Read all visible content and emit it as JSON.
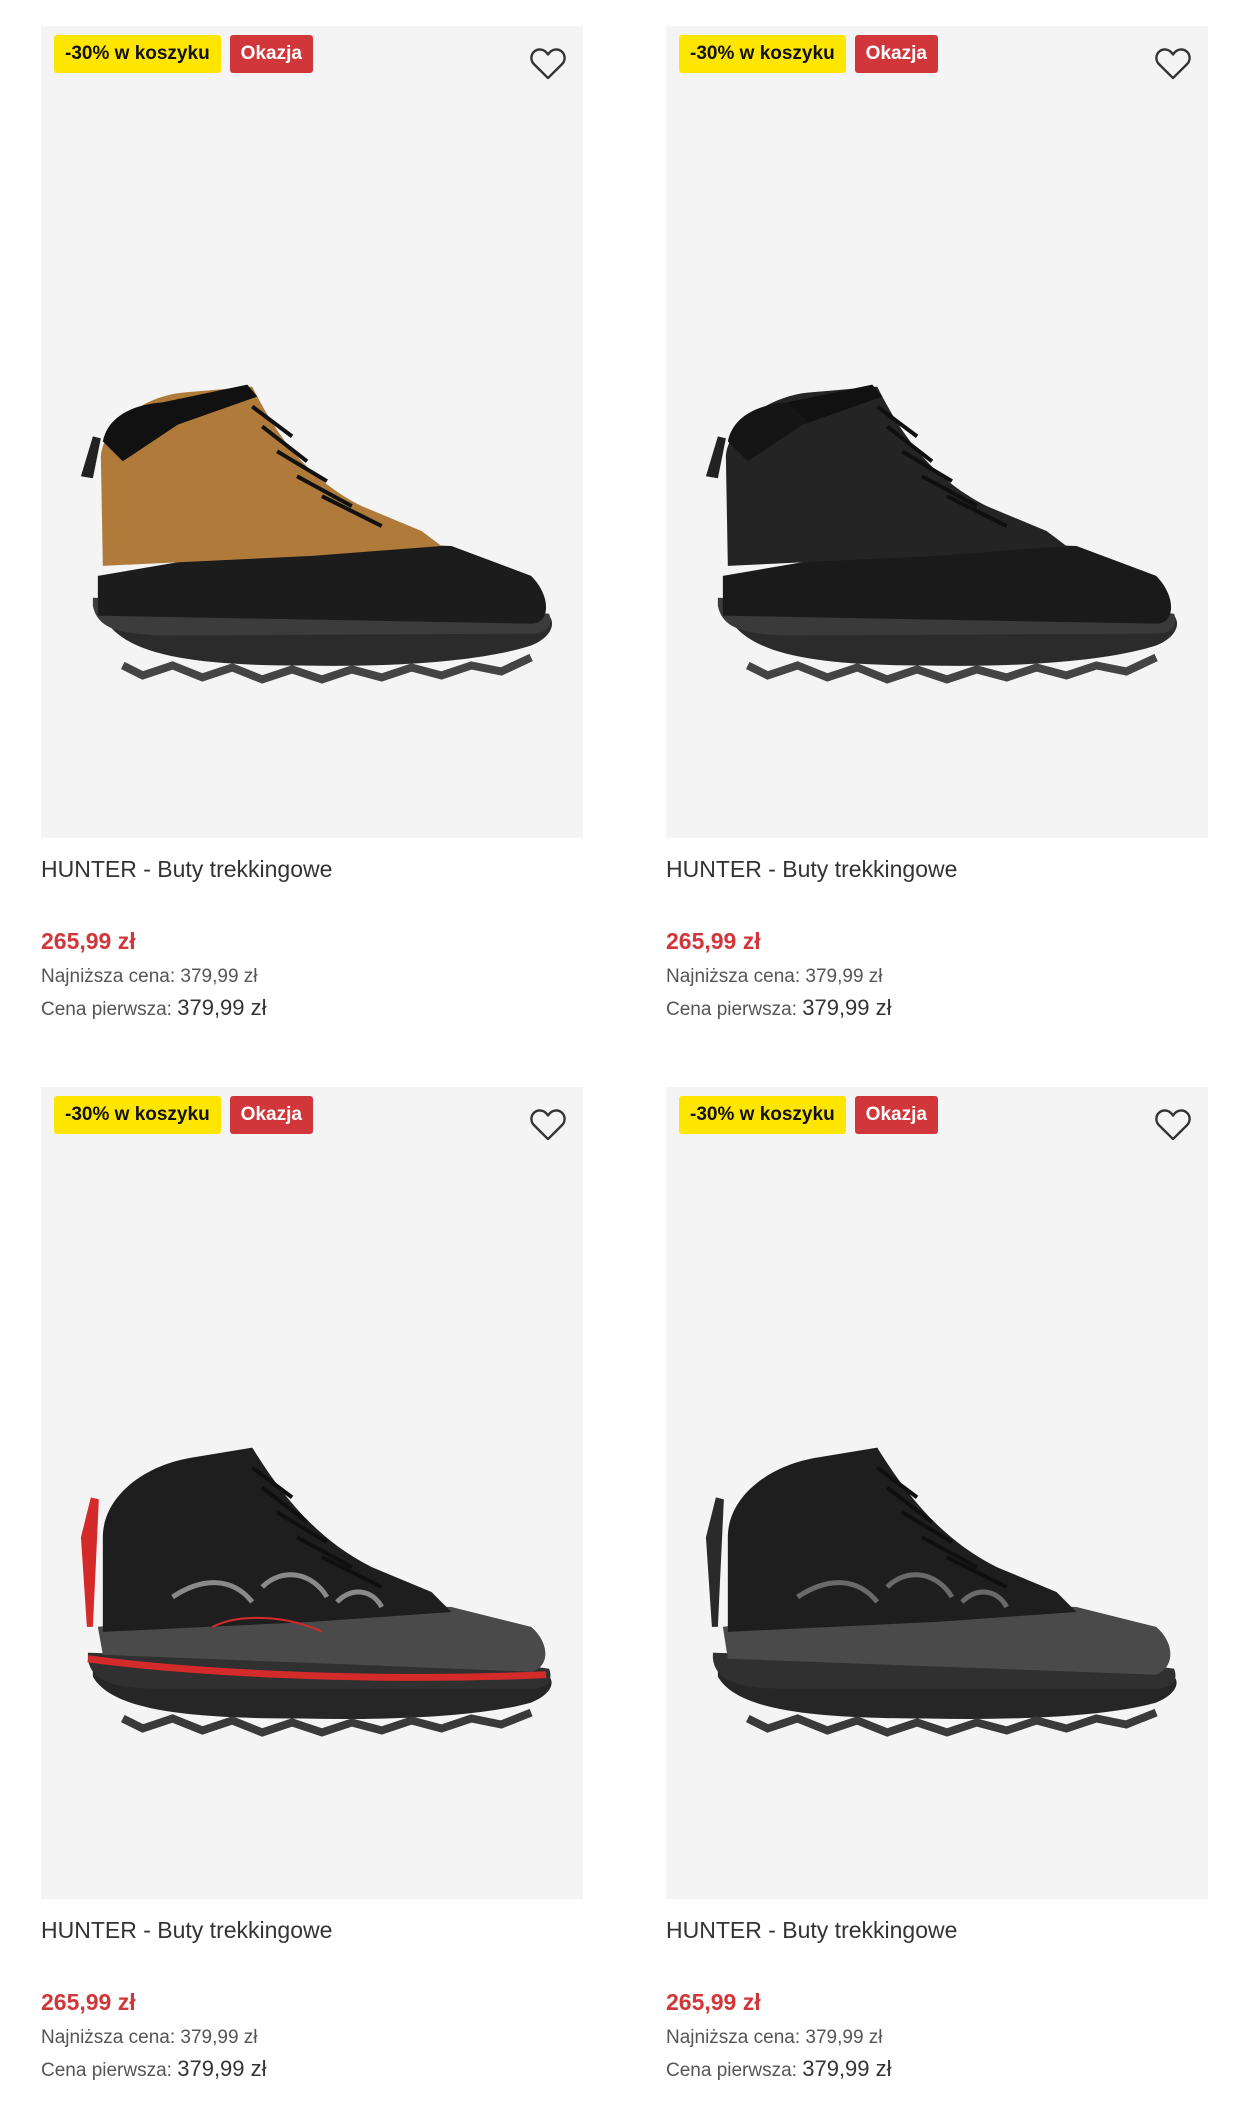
{
  "colors": {
    "accent_red": "#d1373a",
    "badge_yellow": "#ffe600",
    "image_bg": "#f4f4f4"
  },
  "products": [
    {
      "badge_discount": "-30% w koszyku",
      "badge_deal": "Okazja",
      "title": "HUNTER - Buty trekkingowe",
      "price": "265,99 zł",
      "lowest_price": "Najniższa cena: 379,99 zł",
      "first_price_label": "Cena pierwsza:",
      "first_price_value": "379,99 zł",
      "variant": "black-tan"
    },
    {
      "badge_discount": "-30% w koszyku",
      "badge_deal": "Okazja",
      "title": "HUNTER - Buty trekkingowe",
      "price": "265,99 zł",
      "lowest_price": "Najniższa cena: 379,99 zł",
      "first_price_label": "Cena pierwsza:",
      "first_price_value": "379,99 zł",
      "variant": "all-black"
    },
    {
      "badge_discount": "-30% w koszyku",
      "badge_deal": "Okazja",
      "title": "HUNTER - Buty trekkingowe",
      "price": "265,99 zł",
      "lowest_price": "Najniższa cena: 379,99 zł",
      "first_price_label": "Cena pierwsza:",
      "first_price_value": "379,99 zł",
      "variant": "black-red"
    },
    {
      "badge_discount": "-30% w koszyku",
      "badge_deal": "Okazja",
      "title": "HUNTER - Buty trekkingowe",
      "price": "265,99 zł",
      "lowest_price": "Najniższa cena: 379,99 zł",
      "first_price_label": "Cena pierwsza:",
      "first_price_value": "379,99 zł",
      "variant": "black-grey"
    }
  ]
}
